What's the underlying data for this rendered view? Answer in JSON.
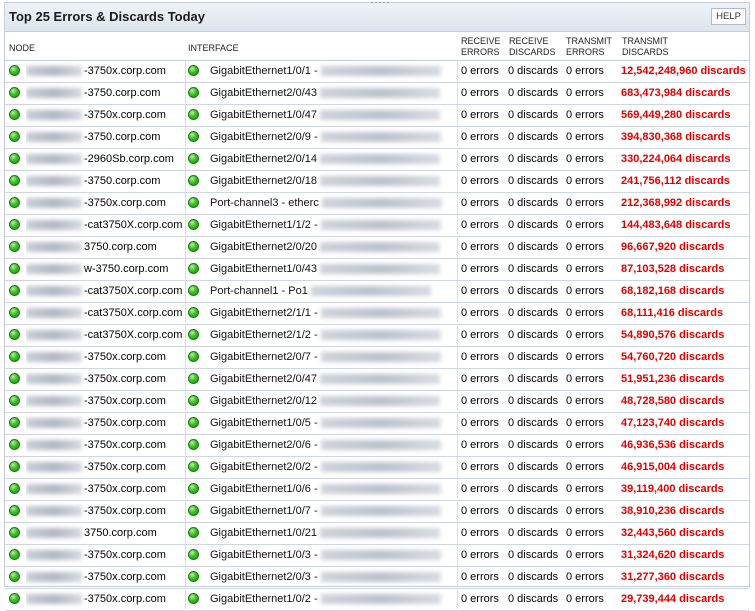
{
  "widget": {
    "title": "Top 25 Errors & Discards Today",
    "help_label": "HELP",
    "status_color": "#3fbf2a",
    "alert_color": "#e00000"
  },
  "columns": {
    "node": "NODE",
    "interface": "INTERFACE",
    "receive_errors": "RECEIVE ERRORS",
    "receive_discards": "RECEIVE DISCARDS",
    "transmit_errors": "TRANSMIT ERRORS",
    "transmit_discards": "TRANSMIT DISCARDS"
  },
  "rows": [
    {
      "node": "-3750x.corp.com",
      "interface": "GigabitEthernet1/0/1 -",
      "rx_err": "0 errors",
      "rx_disc": "0 discards",
      "tx_err": "0 errors",
      "tx_disc": "12,542,248,960 discards"
    },
    {
      "node": "-3750.corp.com",
      "interface": "GigabitEthernet2/0/43",
      "rx_err": "0 errors",
      "rx_disc": "0 discards",
      "tx_err": "0 errors",
      "tx_disc": "683,473,984 discards"
    },
    {
      "node": "-3750x.corp.com",
      "interface": "GigabitEthernet1/0/47",
      "rx_err": "0 errors",
      "rx_disc": "0 discards",
      "tx_err": "0 errors",
      "tx_disc": "569,449,280 discards"
    },
    {
      "node": "-3750.corp.com",
      "interface": "GigabitEthernet2/0/9 -",
      "rx_err": "0 errors",
      "rx_disc": "0 discards",
      "tx_err": "0 errors",
      "tx_disc": "394,830,368 discards"
    },
    {
      "node": "-2960Sb.corp.com",
      "interface": "GigabitEthernet2/0/14",
      "rx_err": "0 errors",
      "rx_disc": "0 discards",
      "tx_err": "0 errors",
      "tx_disc": "330,224,064 discards"
    },
    {
      "node": "-3750.corp.com",
      "interface": "GigabitEthernet2/0/18",
      "rx_err": "0 errors",
      "rx_disc": "0 discards",
      "tx_err": "0 errors",
      "tx_disc": "241,756,112 discards"
    },
    {
      "node": "-3750x.corp.com",
      "interface": "Port-channel3 - etherc",
      "rx_err": "0 errors",
      "rx_disc": "0 discards",
      "tx_err": "0 errors",
      "tx_disc": "212,368,992 discards"
    },
    {
      "node": "-cat3750X.corp.com",
      "interface": "GigabitEthernet1/1/2 -",
      "rx_err": "0 errors",
      "rx_disc": "0 discards",
      "tx_err": "0 errors",
      "tx_disc": "144,483,648 discards"
    },
    {
      "node": "3750.corp.com",
      "interface": "GigabitEthernet2/0/20",
      "rx_err": "0 errors",
      "rx_disc": "0 discards",
      "tx_err": "0 errors",
      "tx_disc": "96,667,920 discards"
    },
    {
      "node": "w-3750.corp.com",
      "interface": "GigabitEthernet1/0/43",
      "rx_err": "0 errors",
      "rx_disc": "0 discards",
      "tx_err": "0 errors",
      "tx_disc": "87,103,528 discards"
    },
    {
      "node": "-cat3750X.corp.com",
      "interface": "Port-channel1 - Po1",
      "rx_err": "0 errors",
      "rx_disc": "0 discards",
      "tx_err": "0 errors",
      "tx_disc": "68,182,168 discards"
    },
    {
      "node": "-cat3750X.corp.com",
      "interface": "GigabitEthernet2/1/1 -",
      "rx_err": "0 errors",
      "rx_disc": "0 discards",
      "tx_err": "0 errors",
      "tx_disc": "68,111,416 discards"
    },
    {
      "node": "-cat3750X.corp.com",
      "interface": "GigabitEthernet2/1/2 -",
      "rx_err": "0 errors",
      "rx_disc": "0 discards",
      "tx_err": "0 errors",
      "tx_disc": "54,890,576 discards"
    },
    {
      "node": "-3750x.corp.com",
      "interface": "GigabitEthernet2/0/7 -",
      "rx_err": "0 errors",
      "rx_disc": "0 discards",
      "tx_err": "0 errors",
      "tx_disc": "54,760,720 discards"
    },
    {
      "node": "-3750x.corp.com",
      "interface": "GigabitEthernet2/0/47",
      "rx_err": "0 errors",
      "rx_disc": "0 discards",
      "tx_err": "0 errors",
      "tx_disc": "51,951,236 discards"
    },
    {
      "node": "-3750x.corp.com",
      "interface": "GigabitEthernet2/0/12",
      "rx_err": "0 errors",
      "rx_disc": "0 discards",
      "tx_err": "0 errors",
      "tx_disc": "48,728,580 discards"
    },
    {
      "node": "-3750x.corp.com",
      "interface": "GigabitEthernet1/0/5 -",
      "rx_err": "0 errors",
      "rx_disc": "0 discards",
      "tx_err": "0 errors",
      "tx_disc": "47,123,740 discards"
    },
    {
      "node": "-3750x.corp.com",
      "interface": "GigabitEthernet2/0/6 -",
      "rx_err": "0 errors",
      "rx_disc": "0 discards",
      "tx_err": "0 errors",
      "tx_disc": "46,936,536 discards"
    },
    {
      "node": "-3750x.corp.com",
      "interface": "GigabitEthernet2/0/2 -",
      "rx_err": "0 errors",
      "rx_disc": "0 discards",
      "tx_err": "0 errors",
      "tx_disc": "46,915,004 discards"
    },
    {
      "node": "-3750x.corp.com",
      "interface": "GigabitEthernet1/0/6 -",
      "rx_err": "0 errors",
      "rx_disc": "0 discards",
      "tx_err": "0 errors",
      "tx_disc": "39,119,400 discards"
    },
    {
      "node": "-3750x.corp.com",
      "interface": "GigabitEthernet1/0/7 -",
      "rx_err": "0 errors",
      "rx_disc": "0 discards",
      "tx_err": "0 errors",
      "tx_disc": "38,910,236 discards"
    },
    {
      "node": "3750.corp.com",
      "interface": "GigabitEthernet1/0/21",
      "rx_err": "0 errors",
      "rx_disc": "0 discards",
      "tx_err": "0 errors",
      "tx_disc": "32,443,560 discards"
    },
    {
      "node": "-3750x.corp.com",
      "interface": "GigabitEthernet1/0/3 -",
      "rx_err": "0 errors",
      "rx_disc": "0 discards",
      "tx_err": "0 errors",
      "tx_disc": "31,324,620 discards"
    },
    {
      "node": "-3750x.corp.com",
      "interface": "GigabitEthernet2/0/3 -",
      "rx_err": "0 errors",
      "rx_disc": "0 discards",
      "tx_err": "0 errors",
      "tx_disc": "31,277,360 discards"
    },
    {
      "node": "-3750x.corp.com",
      "interface": "GigabitEthernet1/0/2 -",
      "rx_err": "0 errors",
      "rx_disc": "0 discards",
      "tx_err": "0 errors",
      "tx_disc": "29,739,444 discards"
    }
  ]
}
